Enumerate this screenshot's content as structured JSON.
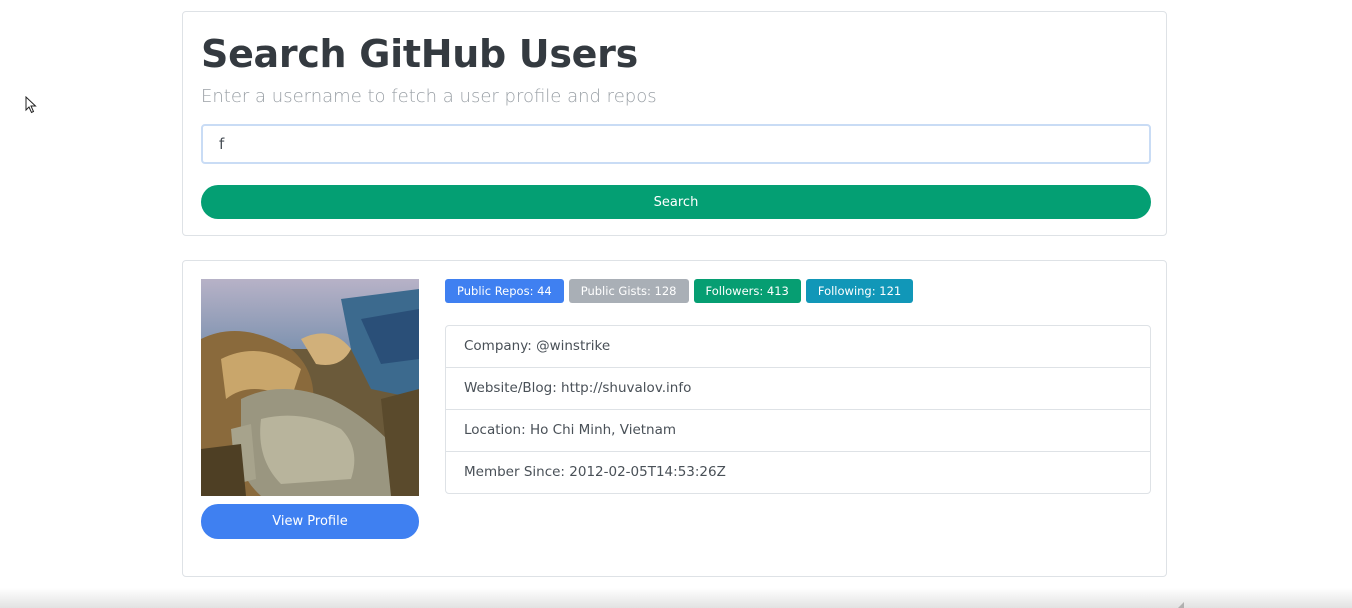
{
  "search": {
    "title": "Search GitHub Users",
    "subtitle": "Enter a username to fetch a user profile and repos",
    "input_value": "f",
    "button_label": "Search"
  },
  "profile": {
    "avatar_alt": "user avatar",
    "view_profile_label": "View Profile",
    "badges": [
      {
        "label": "Public Repos: 44",
        "color": "#3f80f1"
      },
      {
        "label": "Public Gists: 128",
        "color": "#a9afb6"
      },
      {
        "label": "Followers: 413",
        "color": "#069e72"
      },
      {
        "label": "Following: 121",
        "color": "#1197b8"
      }
    ],
    "info": [
      {
        "label": "Company: @winstrike"
      },
      {
        "label": "Website/Blog: http://shuvalov.info"
      },
      {
        "label": "Location: Ho Chi Minh, Vietnam"
      },
      {
        "label": "Member Since: 2012-02-05T14:53:26Z"
      }
    ]
  },
  "colors": {
    "search_button": "#049f73",
    "view_profile_button": "#3f80f1",
    "card_border": "#dee2e6"
  }
}
